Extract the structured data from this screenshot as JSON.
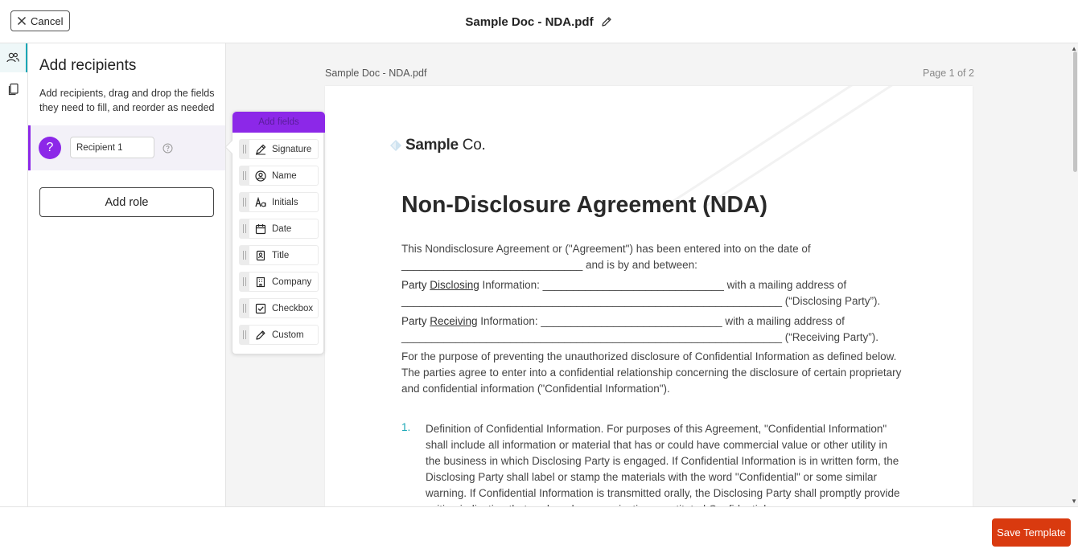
{
  "header": {
    "cancel_label": "Cancel",
    "document_title": "Sample Doc - NDA.pdf"
  },
  "rail": {
    "items": [
      {
        "icon": "recipients-icon",
        "active": true
      },
      {
        "icon": "pages-icon",
        "active": false
      }
    ]
  },
  "panel": {
    "title": "Add recipients",
    "description": "Add recipients, drag and drop the fields they need to fill, and reorder as needed",
    "recipient": {
      "avatar": "?",
      "value": "Recipient 1"
    },
    "add_role_label": "Add role"
  },
  "fields": {
    "header": "Add fields",
    "items": [
      {
        "label": "Signature",
        "icon": "signature-pen-icon"
      },
      {
        "label": "Name",
        "icon": "person-circle-icon"
      },
      {
        "label": "Initials",
        "icon": "initials-icon"
      },
      {
        "label": "Date",
        "icon": "calendar-icon"
      },
      {
        "label": "Title",
        "icon": "badge-icon"
      },
      {
        "label": "Company",
        "icon": "building-icon"
      },
      {
        "label": "Checkbox",
        "icon": "checkbox-icon"
      },
      {
        "label": "Custom",
        "icon": "pencil-icon"
      }
    ]
  },
  "viewer": {
    "file_name": "Sample Doc - NDA.pdf",
    "page_indicator": "Page 1 of 2"
  },
  "document": {
    "logo_text": "Sample",
    "logo_suffix": "Co.",
    "title": "Non-Disclosure Agreement (NDA)",
    "intro_line1": "This Nondisclosure Agreement or (\"Agreement\") has been entered into on the date of",
    "intro_line2": "______________________________ and is by and between:",
    "disclosing_prefix": "Party ",
    "disclosing_word": "Disclosing",
    "disclosing_suffix": " Information: ______________________________ with a mailing address of",
    "disclosing_line2": "_______________________________________________________________ (“Disclosing Party”).",
    "receiving_prefix": "Party ",
    "receiving_word": "Receiving",
    "receiving_suffix": " Information: ______________________________ with a mailing address of",
    "receiving_line2": "_______________________________________________________________ (“Receiving Party”).",
    "purpose": "For the purpose of preventing the unauthorized disclosure of Confidential Information as defined below. The parties agree to enter into a confidential relationship concerning the disclosure of certain proprietary and confidential information (\"Confidential Information\").",
    "item1_number": "1.",
    "item1_text": "Definition of Confidential Information. For purposes of this Agreement, \"Confidential Information\" shall include all information or material that has or could have commercial value or other utility in the business in which Disclosing Party is engaged. If Confidential Information is in written form, the Disclosing Party shall label or stamp the materials with the word \"Confidential\" or some similar warning. If Confidential Information is transmitted orally, the Disclosing Party shall promptly provide writing indicating that such oral communication constituted Confidential"
  },
  "footer": {
    "save_label": "Save Template"
  },
  "colors": {
    "accent_purple": "#8c28e8",
    "accent_teal": "#1aa7b6",
    "save_orange": "#d93a0f"
  }
}
